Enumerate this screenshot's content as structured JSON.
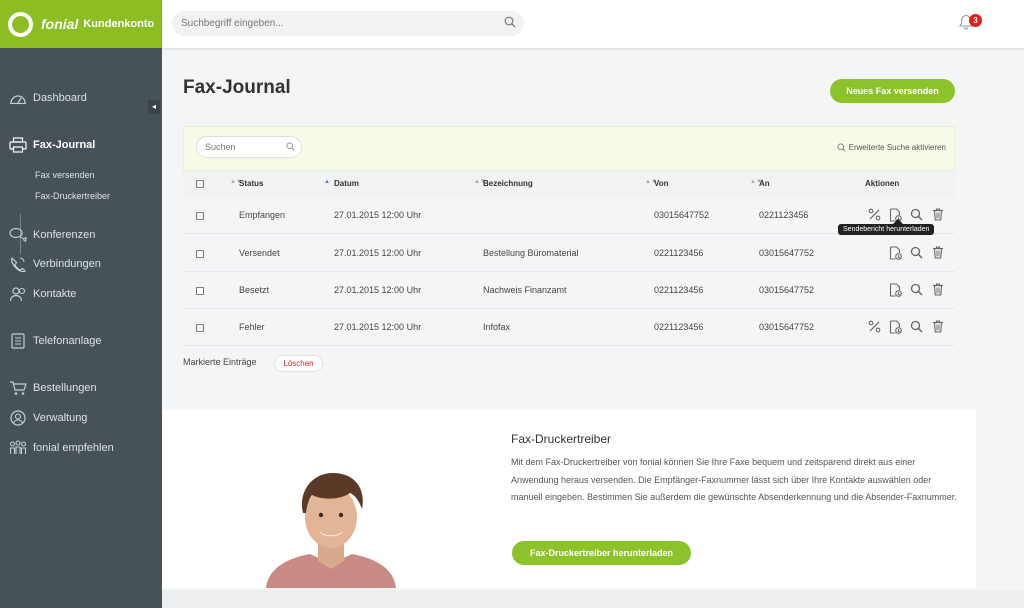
{
  "brand": {
    "name": "fonial",
    "product": "Kundenkonto"
  },
  "topbar": {
    "search_placeholder": "Suchbegriff eingeben...",
    "notification_count": "3"
  },
  "sidebar": {
    "collapse_icon": "◂",
    "items": [
      {
        "label": "Dashboard",
        "icon": "dashboard-icon"
      },
      {
        "label": "Fax-Journal",
        "icon": "printer-icon"
      },
      {
        "label": "Konferenzen",
        "icon": "chat-icon"
      },
      {
        "label": "Verbindungen",
        "icon": "phone-icon"
      },
      {
        "label": "Kontakte",
        "icon": "contacts-icon"
      },
      {
        "label": "Telefonanlage",
        "icon": "pbx-icon"
      },
      {
        "label": "Bestellungen",
        "icon": "cart-icon"
      },
      {
        "label": "Verwaltung",
        "icon": "user-icon"
      },
      {
        "label": "fonial empfehlen",
        "icon": "recommend-icon"
      }
    ],
    "subitems": [
      "Fax versenden",
      "Fax-Druckertreiber"
    ]
  },
  "page": {
    "title": "Fax-Journal",
    "new_fax_button": "Neues Fax versenden"
  },
  "filter": {
    "search_placeholder": "Suchen",
    "advanced_search": "Erweiterte Suche aktivieren"
  },
  "table": {
    "columns": [
      "Status",
      "Datum",
      "Bezeichnung",
      "Von",
      "An",
      "Aktionen"
    ],
    "rows": [
      {
        "status": "Empfangen",
        "datum": "27.01.2015 12:00 Uhr",
        "bezeichnung": "",
        "von": "03015647752",
        "an": "0221123456"
      },
      {
        "status": "Versendet",
        "datum": "27.01.2015 12:00 Uhr",
        "bezeichnung": "Bestellung Büromaterial",
        "von": "0221123456",
        "an": "03015647752"
      },
      {
        "status": "Besetzt",
        "datum": "27.01.2015 12:00 Uhr",
        "bezeichnung": "Nachweis Finanzamt",
        "von": "0221123456",
        "an": "03015647752"
      },
      {
        "status": "Fehler",
        "datum": "27.01.2015 12:00 Uhr",
        "bezeichnung": "Infofax",
        "von": "0221123456",
        "an": "03015647752"
      }
    ],
    "tooltip": "Sendebericht herunterladen",
    "marked_label": "Markierte Einträge",
    "delete_button": "Löschen"
  },
  "promo": {
    "title": "Fax-Druckertreiber",
    "text": "Mit dem Fax-Druckertreiber von fonial können Sie Ihre Faxe bequem und zeitsparend direkt aus einer Anwendung heraus versenden. Die Empfänger-Faxnummer lässt sich über Ihre Kontakte auswählen oder manuell eingeben. Bestimmen Sie außerdem die gewünschte Absenderkennung und die Absender-Faxnummer.",
    "button": "Fax-Druckertreiber herunterladen"
  },
  "colors": {
    "brand_green": "#8cbd23",
    "sidebar_bg": "#465257",
    "button_green": "#8cc32a",
    "delete_red": "#e02020"
  }
}
